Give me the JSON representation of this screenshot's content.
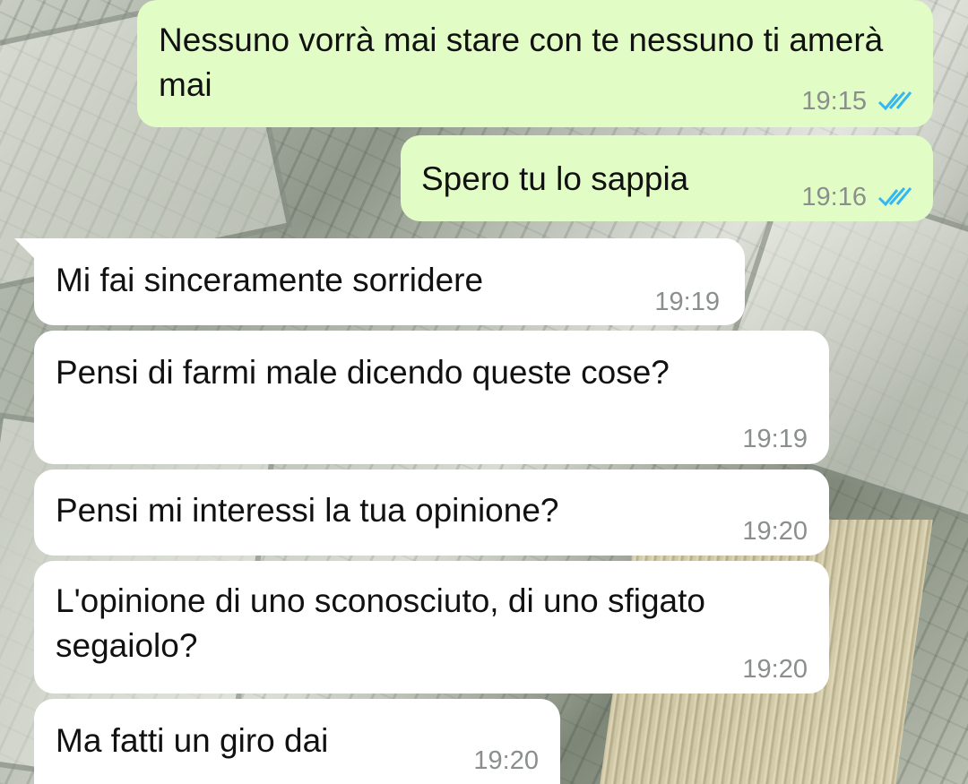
{
  "chat": {
    "messages": [
      {
        "direction": "outgoing",
        "text": "Nessuno vorrà mai stare con te nessuno ti amerà mai",
        "time": "19:15",
        "status_icon": "double-check-read-icon"
      },
      {
        "direction": "outgoing",
        "text": "Spero tu lo sappia",
        "time": "19:16",
        "status_icon": "double-check-read-icon"
      },
      {
        "direction": "incoming",
        "text": "Mi fai sinceramente sorridere",
        "time": "19:19"
      },
      {
        "direction": "incoming",
        "text": "Pensi di farmi male dicendo queste cose?",
        "time": "19:19"
      },
      {
        "direction": "incoming",
        "text": "Pensi mi interessi la tua opinione?",
        "time": "19:20"
      },
      {
        "direction": "incoming",
        "text": "L'opinione di uno sconosciuto, di uno sfigato segaiolo?",
        "time": "19:20"
      },
      {
        "direction": "incoming",
        "text": "Ma fatti un giro dai",
        "time": "19:20"
      }
    ]
  },
  "colors": {
    "outgoing_bubble": "#e2fcc6",
    "incoming_bubble": "#ffffff",
    "read_check": "#34b7f1",
    "timestamp": "#8a8f8c"
  }
}
